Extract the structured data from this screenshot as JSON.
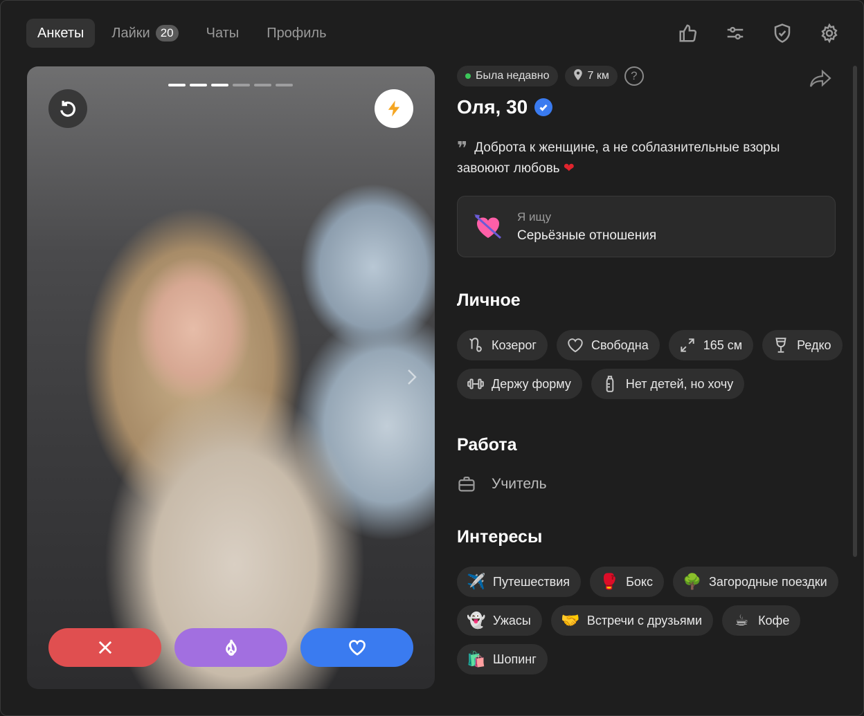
{
  "nav": {
    "tabs": [
      {
        "label": "Анкеты"
      },
      {
        "label": "Лайки",
        "badge": "20"
      },
      {
        "label": "Чаты"
      },
      {
        "label": "Профиль"
      }
    ]
  },
  "top_icons": [
    "thumbs-up-icon",
    "filters-icon",
    "shield-check-icon",
    "settings-gear-icon"
  ],
  "photo": {
    "dots_total": 6,
    "dots_active": 3
  },
  "profile": {
    "status": "Была недавно",
    "distance": "7 км",
    "help": "?",
    "name": "Оля, 30",
    "bio_text": "Доброта к женщине, а не соблазнительные взоры завоюют любовь",
    "bio_emoji": "❤",
    "looking": {
      "label": "Я ищу",
      "value": "Серьёзные отношения"
    },
    "personal": {
      "title": "Личное",
      "chips": [
        {
          "label": "Козерог",
          "icon": "capricorn-icon"
        },
        {
          "label": "Свободна",
          "icon": "heart-icon"
        },
        {
          "label": "165 см",
          "icon": "height-arrows-icon"
        },
        {
          "label": "Редко",
          "icon": "wine-glass-icon"
        },
        {
          "label": "Держу форму",
          "icon": "dumbbell-icon"
        },
        {
          "label": "Нет детей, но хочу",
          "icon": "baby-bottle-icon"
        }
      ]
    },
    "work": {
      "title": "Работа",
      "value": "Учитель"
    },
    "interests": {
      "title": "Интересы",
      "chips": [
        {
          "label": "Путешествия",
          "emoji": "✈️"
        },
        {
          "label": "Бокс",
          "emoji": "🥊"
        },
        {
          "label": "Загородные поездки",
          "emoji": "🌳"
        },
        {
          "label": "Ужасы",
          "emoji": "👻"
        },
        {
          "label": "Встречи с друзьями",
          "emoji": "🤝"
        },
        {
          "label": "Кофе",
          "emoji": "☕"
        },
        {
          "label": "Шопинг",
          "emoji": "🛍️"
        }
      ]
    }
  },
  "colors": {
    "dislike": "#e04f50",
    "superlike": "#a26fe0",
    "like": "#3a7bf0",
    "verified": "#3a7bf0",
    "online_dot": "#3cc75a"
  }
}
